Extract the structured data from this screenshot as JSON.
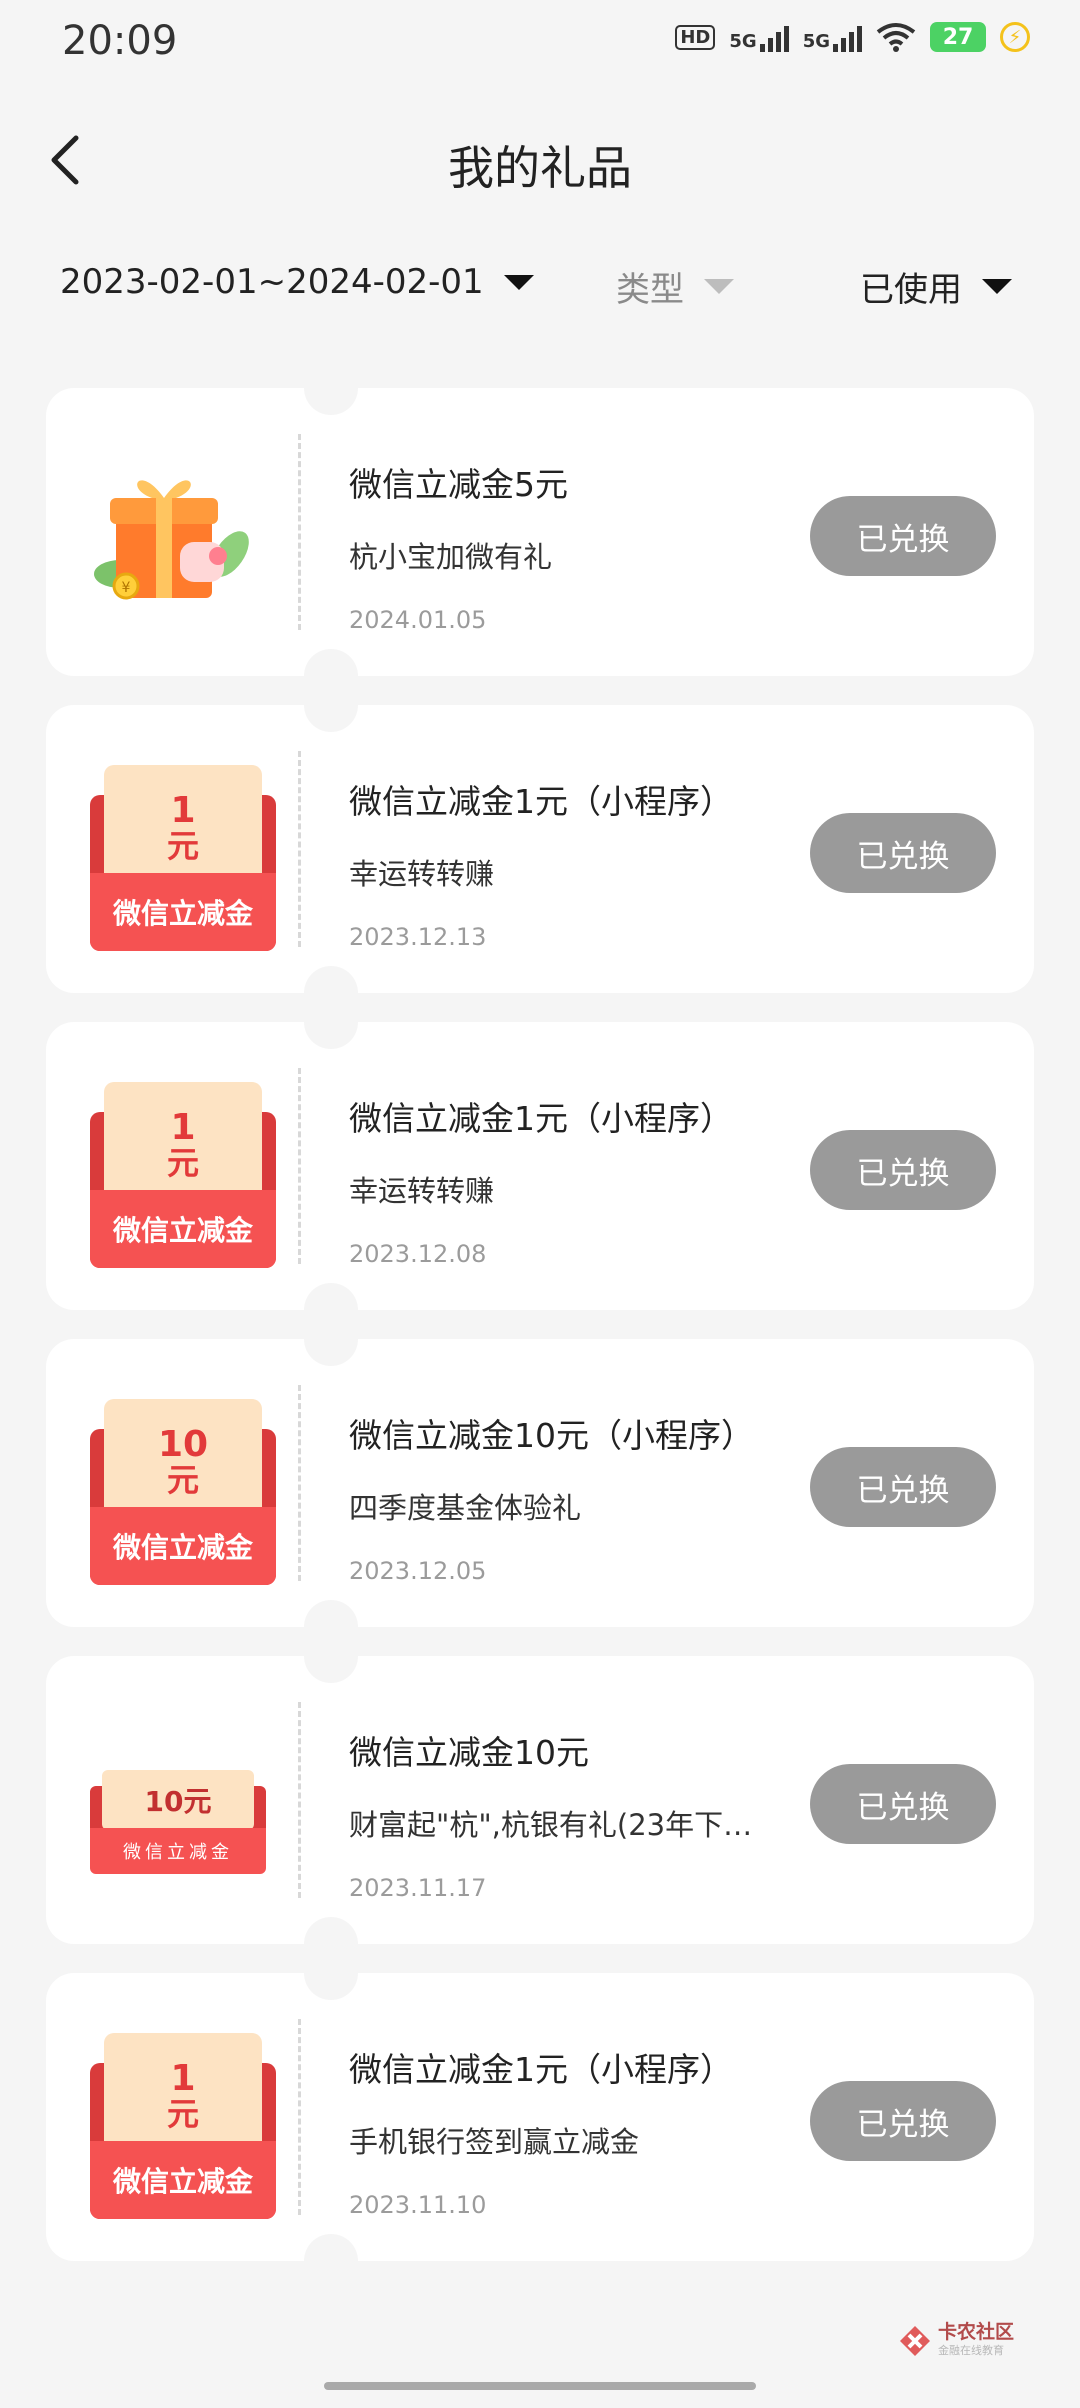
{
  "status_bar": {
    "time": "20:09",
    "hd_label": "HD",
    "signal1": "5G",
    "signal2": "5G",
    "battery": "27",
    "icons": [
      "hd-icon",
      "signal-icon",
      "signal-icon",
      "wifi-icon",
      "battery-icon",
      "charging-icon"
    ]
  },
  "header": {
    "title": "我的礼品",
    "back_icon": "chevron-left-icon"
  },
  "filters": {
    "date_range": "2023-02-01~2024-02-01",
    "type": "类型",
    "status": "已使用"
  },
  "gifts": [
    {
      "title": "微信立减金5元",
      "source": "杭小宝加微有礼",
      "date": "2024.01.05",
      "button": "已兑换",
      "thumb": "gift-box"
    },
    {
      "title": "微信立减金1元（小程序）",
      "source": "幸运转转赚",
      "date": "2023.12.13",
      "button": "已兑换",
      "thumb": "red-envelope",
      "thumb_amount": "1",
      "thumb_unit": "元",
      "thumb_label": "微信立减金"
    },
    {
      "title": "微信立减金1元（小程序）",
      "source": "幸运转转赚",
      "date": "2023.12.08",
      "button": "已兑换",
      "thumb": "red-envelope",
      "thumb_amount": "1",
      "thumb_unit": "元",
      "thumb_label": "微信立减金"
    },
    {
      "title": "微信立减金10元（小程序）",
      "source": "四季度基金体验礼",
      "date": "2023.12.05",
      "button": "已兑换",
      "thumb": "red-envelope",
      "thumb_amount": "10",
      "thumb_unit": "元",
      "thumb_label": "微信立减金"
    },
    {
      "title": "微信立减金10元",
      "source": "财富起\"杭\",杭银有礼(23年下…",
      "date": "2023.11.17",
      "button": "已兑换",
      "thumb": "red-envelope-small",
      "thumb_amount": "10元",
      "thumb_label": "微信立减金"
    },
    {
      "title": "微信立减金1元（小程序）",
      "source": "手机银行签到赢立减金",
      "date": "2023.11.10",
      "button": "已兑换",
      "thumb": "red-envelope",
      "thumb_amount": "1",
      "thumb_unit": "元",
      "thumb_label": "微信立减金"
    }
  ],
  "watermark": {
    "name": "卡农社区",
    "tagline": "金融在线教育"
  },
  "colors": {
    "background": "#f5f5f5",
    "button_gray": "#9a9a9a",
    "envelope_red": "#f55252",
    "envelope_cream": "#fde3c3"
  }
}
